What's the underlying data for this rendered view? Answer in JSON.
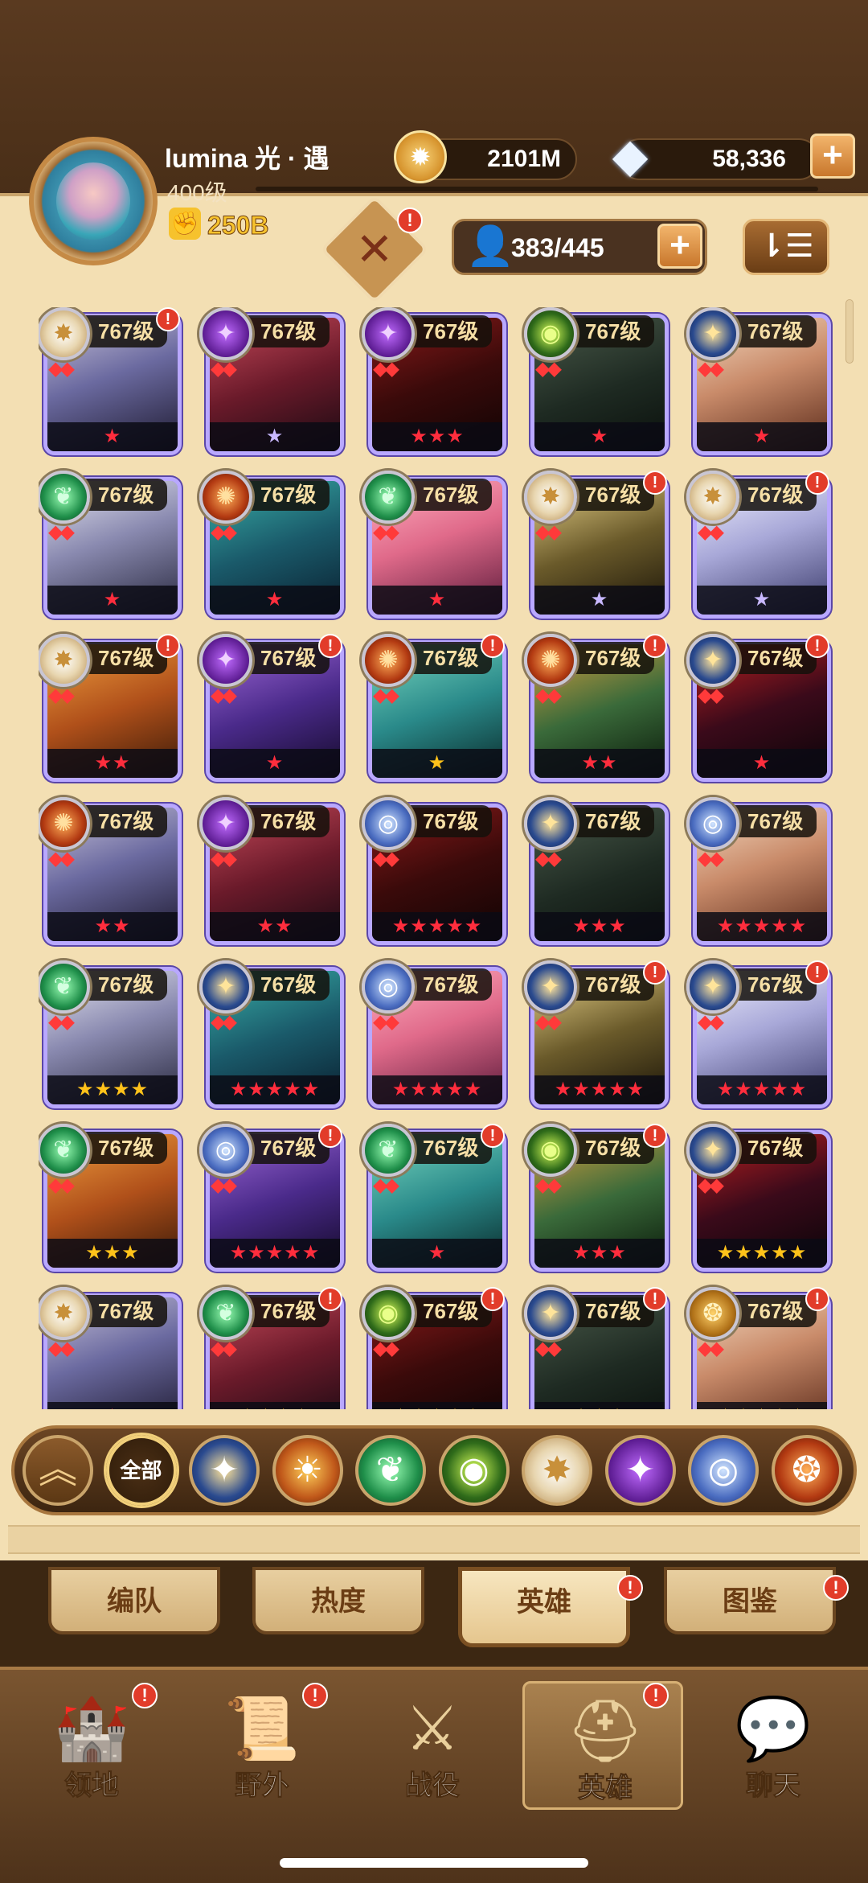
{
  "player": {
    "name": "lumina 光 · 遇",
    "level": "400级",
    "power": "250B"
  },
  "resources": {
    "gold": "2101M",
    "gems": "58,336"
  },
  "hero_count": "383/445",
  "badge_mark": "!",
  "icons": {
    "power": "fist-icon",
    "gold": "gold-coin-icon",
    "gem": "diamond-icon",
    "plus": "plus-icon",
    "sort": "sort-icon",
    "emblem": "crossed-swords-emblem-icon",
    "person": "person-icon"
  },
  "heroes": [
    {
      "level": "767级",
      "faction": "light",
      "stars": "★",
      "star_color": "red",
      "badge": true
    },
    {
      "level": "767级",
      "faction": "dark",
      "stars": "★",
      "star_color": "lilac",
      "badge": false
    },
    {
      "level": "767级",
      "faction": "dark",
      "stars": "★★★",
      "star_color": "red",
      "badge": false
    },
    {
      "level": "767级",
      "faction": "graveborn",
      "stars": "★",
      "star_color": "red",
      "badge": false
    },
    {
      "level": "767级",
      "faction": "celestial",
      "stars": "★",
      "star_color": "red",
      "badge": false
    },
    {
      "level": "767级",
      "faction": "wilder",
      "stars": "★",
      "star_color": "red",
      "badge": false
    },
    {
      "level": "767级",
      "faction": "mauler",
      "stars": "★",
      "star_color": "red",
      "badge": false
    },
    {
      "level": "767级",
      "faction": "wilder",
      "stars": "★",
      "star_color": "red",
      "badge": false
    },
    {
      "level": "767级",
      "faction": "light",
      "stars": "★",
      "star_color": "lilac",
      "badge": true
    },
    {
      "level": "767级",
      "faction": "light",
      "stars": "★",
      "star_color": "lilac",
      "badge": true
    },
    {
      "level": "767级",
      "faction": "light",
      "stars": "★★",
      "star_color": "red",
      "badge": true
    },
    {
      "level": "767级",
      "faction": "dark",
      "stars": "★",
      "star_color": "red",
      "badge": true
    },
    {
      "level": "767级",
      "faction": "mauler",
      "stars": "★",
      "star_color": "gold",
      "badge": true
    },
    {
      "level": "767级",
      "faction": "mauler",
      "stars": "★★",
      "star_color": "red",
      "badge": true
    },
    {
      "level": "767级",
      "faction": "celestial",
      "stars": "★",
      "star_color": "red",
      "badge": true
    },
    {
      "level": "767级",
      "faction": "mauler",
      "stars": "★★",
      "star_color": "red",
      "badge": false
    },
    {
      "level": "767级",
      "faction": "dark",
      "stars": "★★",
      "star_color": "red",
      "badge": false
    },
    {
      "level": "767级",
      "faction": "blue",
      "stars": "★★★★★",
      "star_color": "red",
      "badge": false
    },
    {
      "level": "767级",
      "faction": "celestial",
      "stars": "★★★",
      "star_color": "red",
      "badge": false
    },
    {
      "level": "767级",
      "faction": "blue",
      "stars": "★★★★★",
      "star_color": "red",
      "badge": false
    },
    {
      "level": "767级",
      "faction": "wilder",
      "stars": "★★★★",
      "star_color": "gold",
      "badge": false
    },
    {
      "level": "767级",
      "faction": "celestial",
      "stars": "★★★★★",
      "star_color": "red",
      "badge": false
    },
    {
      "level": "767级",
      "faction": "blue",
      "stars": "★★★★★",
      "star_color": "red",
      "badge": false
    },
    {
      "level": "767级",
      "faction": "celestial",
      "stars": "★★★★★",
      "star_color": "red",
      "badge": true
    },
    {
      "level": "767级",
      "faction": "celestial",
      "stars": "★★★★★",
      "star_color": "red",
      "badge": true
    },
    {
      "level": "767级",
      "faction": "wilder",
      "stars": "★★★",
      "star_color": "gold",
      "badge": false
    },
    {
      "level": "767级",
      "faction": "blue",
      "stars": "★★★★★",
      "star_color": "red",
      "badge": true
    },
    {
      "level": "767级",
      "faction": "wilder",
      "stars": "★",
      "star_color": "red",
      "badge": true
    },
    {
      "level": "767级",
      "faction": "graveborn",
      "stars": "★★★",
      "star_color": "red",
      "badge": true
    },
    {
      "level": "767级",
      "faction": "celestial",
      "stars": "★★★★★",
      "star_color": "gold",
      "badge": false
    },
    {
      "level": "767级",
      "faction": "light",
      "stars": "★",
      "star_color": "red",
      "badge": false
    },
    {
      "level": "767级",
      "faction": "wilder",
      "stars": "★★★★",
      "star_color": "gold",
      "badge": true
    },
    {
      "level": "767级",
      "faction": "graveborn",
      "stars": "★★★★★",
      "star_color": "gold",
      "badge": true
    },
    {
      "level": "767级",
      "faction": "celestial",
      "stars": "★★★",
      "star_color": "gold",
      "badge": true
    },
    {
      "level": "767级",
      "faction": "gold",
      "stars": "★★★★★",
      "star_color": "gold",
      "badge": true
    }
  ],
  "faction_filters": [
    {
      "name": "collapse",
      "label": "︽"
    },
    {
      "name": "all",
      "label": "全部"
    },
    {
      "name": "lightbearer",
      "label": "✦"
    },
    {
      "name": "mauler",
      "label": "☀"
    },
    {
      "name": "wilder",
      "label": "❦"
    },
    {
      "name": "graveborn",
      "label": "◉"
    },
    {
      "name": "celestial",
      "label": "✸"
    },
    {
      "name": "hypogean",
      "label": "✦"
    },
    {
      "name": "dimensional",
      "label": "◎"
    },
    {
      "name": "dragon",
      "label": "❂"
    }
  ],
  "subtabs": [
    "编队",
    "热度",
    "英雄",
    "图鉴"
  ],
  "active_subtab": "英雄",
  "nav": [
    {
      "label": "领地",
      "icon": "castle-icon",
      "badge": true
    },
    {
      "label": "野外",
      "icon": "map-scroll-icon",
      "badge": true
    },
    {
      "label": "战役",
      "icon": "crossed-swords-icon",
      "badge": false
    },
    {
      "label": "英雄",
      "icon": "helmet-icon",
      "badge": true
    },
    {
      "label": "聊天",
      "icon": "chat-bubble-icon",
      "badge": false
    }
  ],
  "active_nav": "英雄"
}
